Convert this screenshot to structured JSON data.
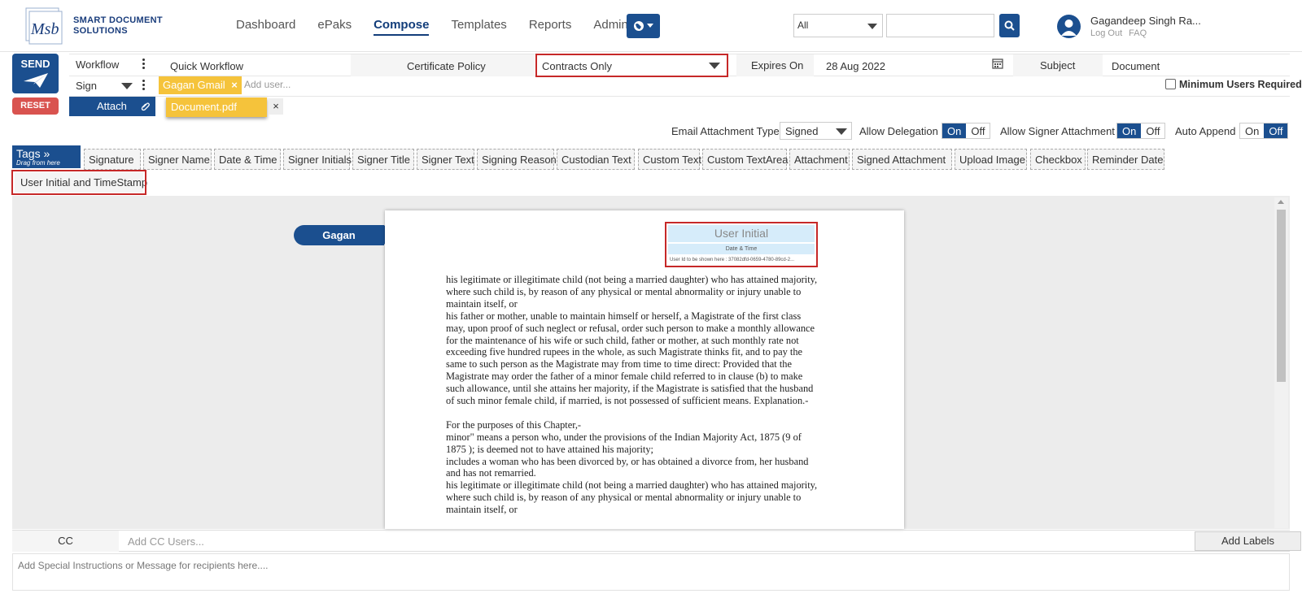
{
  "brand": {
    "line1": "SMART DOCUMENT",
    "line2": "SOLUTIONS",
    "mark": "Msb"
  },
  "nav": {
    "items": [
      "Dashboard",
      "ePaks",
      "Compose",
      "Templates",
      "Reports",
      "Admin"
    ],
    "active": "Compose"
  },
  "search": {
    "scope": "All",
    "placeholder": ""
  },
  "user": {
    "name": "Gagandeep Singh Ra...",
    "logout": "Log Out",
    "faq": "FAQ"
  },
  "compose": {
    "send_label": "SEND",
    "reset_label": "RESET",
    "workflow_label": "Workflow",
    "workflow_value": "Quick Workflow",
    "cert_policy_label": "Certificate Policy",
    "cert_policy_value": "Contracts Only",
    "expires_label": "Expires On",
    "expires_value": "28 Aug 2022",
    "subject_label": "Subject",
    "subject_value": "Document",
    "sign_label": "Sign",
    "signer_chip": "Gagan Gmail",
    "add_user_placeholder": "Add user...",
    "min_users_label": "Minimum Users Required",
    "attach_label": "Attach",
    "document_chip": "Document.pdf"
  },
  "options": {
    "email_attachment_type_label": "Email Attachment Type",
    "email_attachment_type_value": "Signed",
    "allow_delegation_label": "Allow Delegation",
    "allow_signer_attachment_label": "Allow Signer Attachment",
    "auto_append_label": "Auto Append",
    "on_label": "On",
    "off_label": "Off"
  },
  "tags": {
    "title": "Tags »",
    "hint": "Drag from here",
    "items": [
      "Signature",
      "Signer Name",
      "Date & Time",
      "Signer Initials",
      "Signer Title",
      "Signer Text",
      "Signing Reason",
      "Custodian Text",
      "Custom Text",
      "Custom TextArea",
      "Attachment",
      "Signed Attachment",
      "Upload Image",
      "Checkbox",
      "Reminder Date",
      "User Initial and TimeStamp"
    ]
  },
  "document": {
    "signer_flag": "Gagan",
    "stamp": {
      "title": "User Initial",
      "datetime": "Date & Time",
      "userid": "User Id to be shown here : 37082dfd-0659-4780-89cd-2..."
    },
    "lines": [
      "his legitimate or illegitimate child (not being a married daughter) who has attained majority,",
      "where such child is, by reason of any physical or mental abnormality or injury unable to",
      "maintain itself, or",
      "his father or mother, unable to maintain himself or herself, a Magistrate of the first class",
      "may, upon proof of such neglect or refusal, order such person to make a monthly allowance",
      "for the maintenance of his wife or such child, father or mother, at such monthly rate not",
      "exceeding five hundred rupees in the whole, as such Magistrate thinks fit, and to pay the",
      "same to such person as the Magistrate may from time to time direct: Provided that the",
      "Magistrate may order the father of a minor female child referred to in clause (b) to make",
      "such allowance, until she attains her majority, if the Magistrate is satisfied that the husband",
      "of such minor female child, if married, is not possessed of sufficient means. Explanation.-",
      "",
      "For the purposes of this Chapter,-",
      "minor\" means a person who, under the provisions of the Indian Majority Act, 1875 (9 of",
      "1875 ); is deemed not to have attained his majority;",
      "includes a woman who has been divorced by, or has obtained a divorce from, her husband",
      "and has not remarried.",
      "his legitimate or illegitimate child (not being a married daughter) who has attained majority,",
      "where such child is, by reason of any physical or mental abnormality or injury unable to",
      "maintain itself, or"
    ]
  },
  "bottom": {
    "cc_label": "CC",
    "cc_placeholder": "Add CC Users...",
    "add_labels": "Add Labels",
    "message_placeholder": "Add Special Instructions or Message for recipients here...."
  },
  "colors": {
    "primary": "#1b4f8f",
    "highlight": "#c62828",
    "chip": "#f5c33b",
    "danger": "#d9534f"
  }
}
